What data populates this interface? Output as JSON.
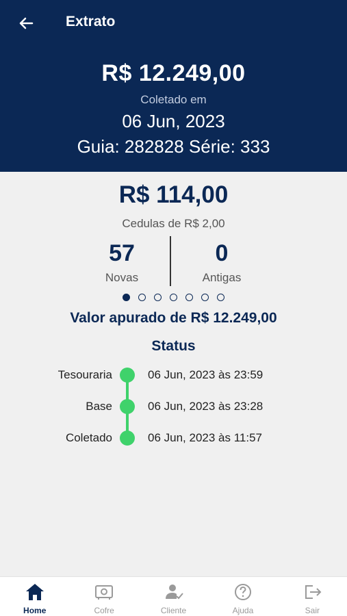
{
  "header": {
    "title": "Extrato",
    "total_amount": "R$ 12.249,00",
    "collected_label": "Coletado em",
    "collected_date": "06 Jun, 2023",
    "guia_line": "Guia: 282828 Série: 333"
  },
  "bill": {
    "amount": "R$ 114,00",
    "description": "Cedulas de R$ 2,00",
    "new_count": "57",
    "new_label": "Novas",
    "old_count": "0",
    "old_label": "Antigas"
  },
  "pager": {
    "total": 7,
    "active": 0
  },
  "valor_apurado": "Valor apurado de R$ 12.249,00",
  "status": {
    "title": "Status",
    "items": [
      {
        "name": "Tesouraria",
        "time": "06 Jun, 2023 às 23:59"
      },
      {
        "name": "Base",
        "time": "06 Jun, 2023 às 23:28"
      },
      {
        "name": "Coletado",
        "time": "06 Jun, 2023 às 11:57"
      }
    ]
  },
  "nav": {
    "items": [
      {
        "label": "Home",
        "icon": "home-icon",
        "active": true
      },
      {
        "label": "Cofre",
        "icon": "safe-icon",
        "active": false
      },
      {
        "label": "Cliente",
        "icon": "client-icon",
        "active": false
      },
      {
        "label": "Ajuda",
        "icon": "help-icon",
        "active": false
      },
      {
        "label": "Sair",
        "icon": "logout-icon",
        "active": false
      }
    ]
  },
  "colors": {
    "primary": "#0b2855",
    "status_green": "#3fd26b",
    "background": "#f0f0f0"
  }
}
